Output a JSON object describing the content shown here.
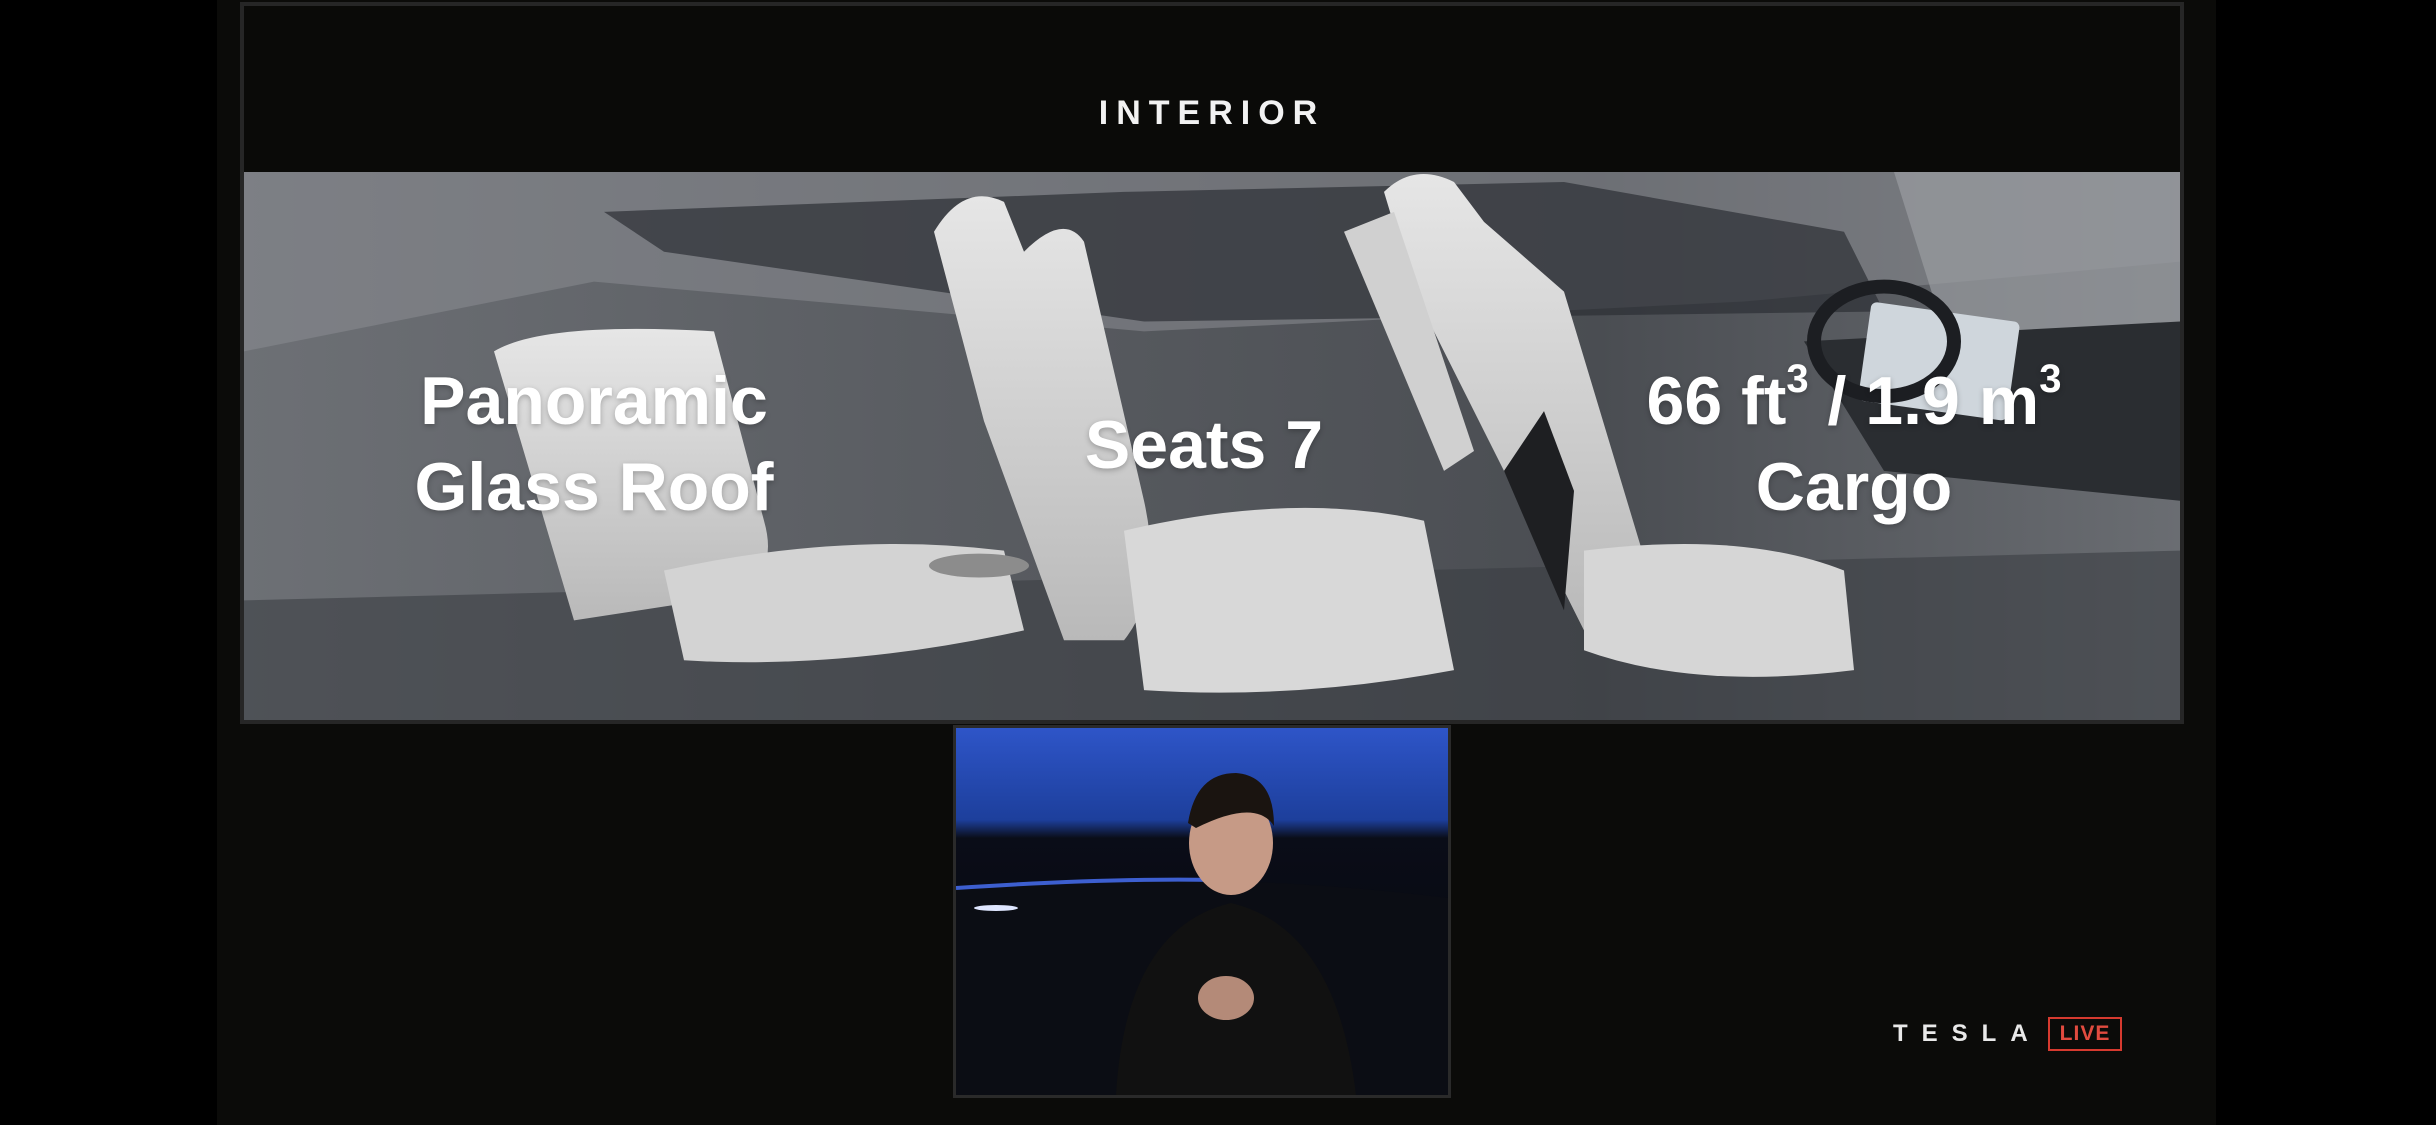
{
  "slide": {
    "title": "INTERIOR",
    "features": {
      "roof": {
        "line1": "Panoramic",
        "line2": "Glass Roof"
      },
      "seats": {
        "line1": "Seats 7"
      },
      "cargo": {
        "part1": "66 ft",
        "sup1": "3",
        "part2": " / 1.9 m",
        "sup2": "3",
        "line2": "Cargo"
      }
    }
  },
  "video": {
    "description_icon": "presenter-video"
  },
  "brand": {
    "wordmark": "TESLA",
    "badge": "LIVE",
    "badge_color": "#d63a2f"
  },
  "colors": {
    "background": "#000000",
    "stage": "#0b0b09",
    "accent": "#d63a2f"
  }
}
